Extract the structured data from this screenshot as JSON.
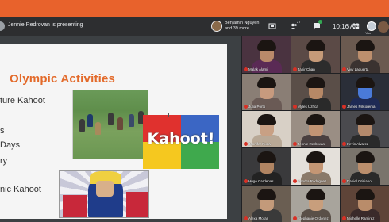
{
  "header": {
    "presenting_text": "Jennie Redrovan is presenting",
    "owner_line1": "Benjamin Nguyen",
    "owner_line2": "and 39 more",
    "people_count": "27",
    "chat_count": "3",
    "time": "10:16 AM",
    "you_label": "You"
  },
  "slide": {
    "title": "Olympic Activities",
    "lines": [
      "ture Kahoot",
      "s",
      "Days",
      "ry",
      "nic Kahoot"
    ],
    "kahoot_text": "Kahoot!"
  },
  "participants": [
    {
      "name": "Malak Alami",
      "skin": "#b98a6a",
      "bg": "#4a3340",
      "shirt": "#5a2a55"
    },
    {
      "name": "Jahir Chan",
      "skin": "#c59a78",
      "bg": "#5b4a46",
      "shirt": "#2c2c2c"
    },
    {
      "name": "Vivy Laguerta",
      "skin": "#bd8f6d",
      "bg": "#6b5a50",
      "shirt": "#3a3230"
    },
    {
      "name": "Julia Porto",
      "skin": "#c79a7e",
      "bg": "#8a7e75",
      "shirt": "#6a5a55"
    },
    {
      "name": "Myles Uzhca",
      "skin": "#b68866",
      "bg": "#5a4e48",
      "shirt": "#2a2a2a"
    },
    {
      "name": "James Pillcorema",
      "skin": "#4a7ad8",
      "bg": "#2a2e38",
      "shirt": "#1e2a55"
    },
    {
      "name": "Jennifer Puna",
      "skin": "#c8a084",
      "bg": "#d8d0c6",
      "shirt": "#b8a896"
    },
    {
      "name": "Jennie Redrovan",
      "skin": "#c29474",
      "bg": "#9a8e84",
      "shirt": "#4a4040"
    },
    {
      "name": "Kevin Alvarez",
      "skin": "#b48a6c",
      "bg": "#4a4a4e",
      "shirt": "#2a2a2a"
    },
    {
      "name": "Hugo Cardenas",
      "skin": "#b08462",
      "bg": "#3a3a3c",
      "shirt": "#222"
    },
    {
      "name": "Kendra Rodriguez",
      "skin": "#c49674",
      "bg": "#e4e0da",
      "shirt": "#8a7a6a"
    },
    {
      "name": "Daniel Otiniano",
      "skin": "#bb8e6c",
      "bg": "#7a746c",
      "shirt": "#2a2a2a"
    },
    {
      "name": "Alexa Moran",
      "skin": "#c39a7a",
      "bg": "#6a5e52",
      "shirt": "#3a3a3a"
    },
    {
      "name": "Stephanie Ordonez",
      "skin": "#c89e7c",
      "bg": "#a8a49c",
      "shirt": "#5a5048"
    },
    {
      "name": "Michelle Ramirez",
      "skin": "#b98c6a",
      "bg": "#5e4438",
      "shirt": "#3a2a2a"
    }
  ],
  "colors": {
    "accent_orange": "#e8622c",
    "kahoot_red": "#e0312e",
    "kahoot_blue": "#3b66c4",
    "kahoot_yellow": "#f5c81f",
    "kahoot_green": "#3fa94d",
    "slide_title": "#e36a2a"
  },
  "icons": [
    "present-icon",
    "people-icon",
    "chat-icon",
    "activities-icon",
    "grid-icon"
  ]
}
